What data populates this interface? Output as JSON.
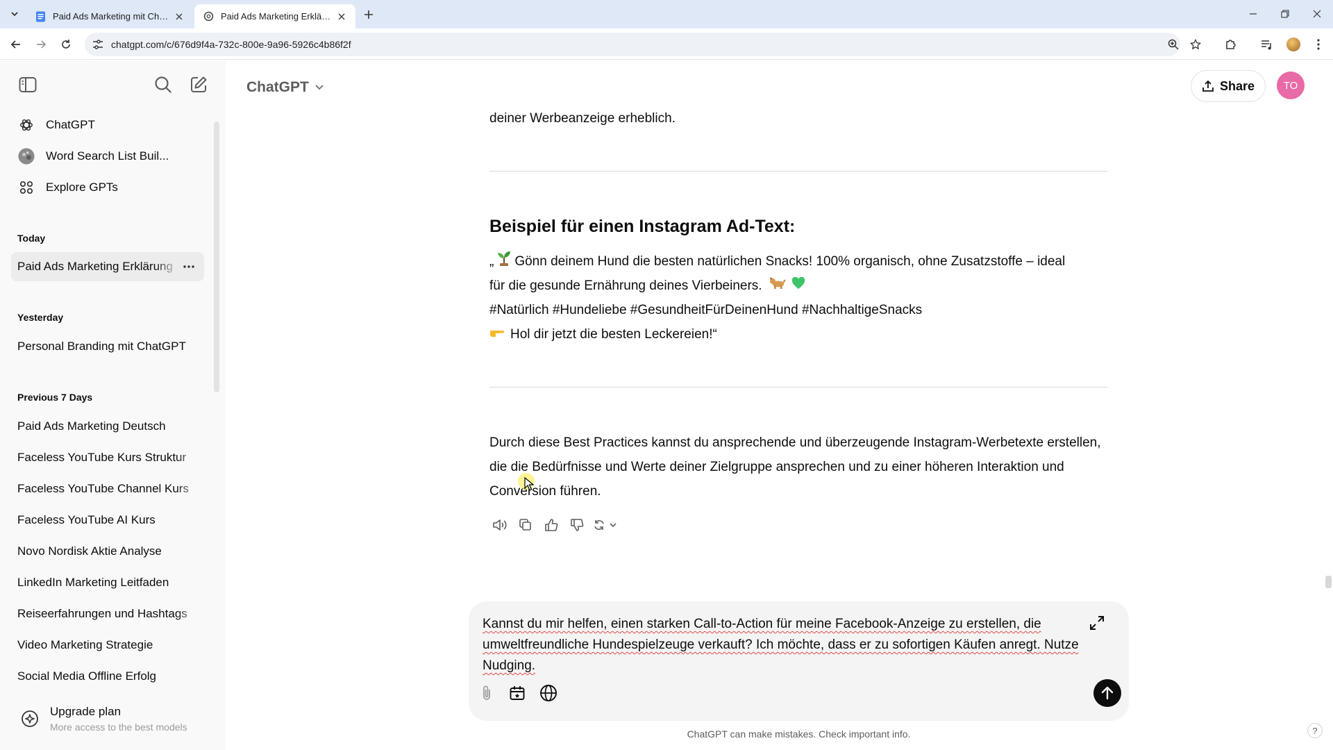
{
  "browser": {
    "tabs": [
      {
        "title": "Paid Ads Marketing mit ChatGPT",
        "active": false
      },
      {
        "title": "Paid Ads Marketing Erklärung",
        "active": true
      }
    ],
    "url": "chatgpt.com/c/676d9f4a-732c-800e-9a96-5926c4b86f2f"
  },
  "sidebar": {
    "top_items": [
      {
        "label": "ChatGPT",
        "icon": "openai-logo-icon"
      },
      {
        "label": "Word Search List Buil...",
        "icon": "gpt-avatar-icon"
      },
      {
        "label": "Explore GPTs",
        "icon": "grid-icon"
      }
    ],
    "sections": [
      {
        "heading": "Today",
        "items": [
          "Paid Ads Marketing Erklärung"
        ]
      },
      {
        "heading": "Yesterday",
        "items": [
          "Personal Branding mit ChatGPT"
        ]
      },
      {
        "heading": "Previous 7 Days",
        "items": [
          "Paid Ads Marketing Deutsch",
          "Faceless YouTube Kurs Struktur",
          "Faceless YouTube Channel Kurs",
          "Faceless YouTube AI Kurs",
          "Novo Nordisk Aktie Analyse",
          "LinkedIn Marketing Leitfaden",
          "Reiseerfahrungen und Hashtags",
          "Video Marketing Strategie",
          "Social Media Offline Erfolg"
        ]
      }
    ],
    "upgrade": {
      "title": "Upgrade plan",
      "subtitle": "More access to the best models"
    }
  },
  "header": {
    "model": "ChatGPT",
    "share_label": "Share",
    "avatar_initials": "TO"
  },
  "conversation": {
    "intro_line": "deiner Werbeanzeige erheblich.",
    "ad_heading": "Beispiel für einen Instagram Ad-Text:",
    "ad_lines": {
      "line1_prefix": "„",
      "line1_text": "Gönn deinem Hund die besten natürlichen Snacks! 100% organisch, ohne Zusatzstoffe – ideal",
      "line2_text": "für die gesunde Ernährung deines Vierbeiners.",
      "line3_text": "#Natürlich #Hundeliebe #GesundheitFürDeinenHund #NachhaltigeSnacks",
      "line4_text": "Hol dir jetzt die besten Leckereien!“"
    },
    "closing_paragraph": "Durch diese Best Practices kannst du ansprechende und überzeugende Instagram-Werbetexte erstellen, die die Bedürfnisse und Werte deiner Zielgruppe ansprechen und zu einer höheren Interaktion und Conversion führen."
  },
  "composer": {
    "text": "Kannst du mir helfen, einen starken Call-to-Action für meine Facebook-Anzeige zu erstellen, die umweltfreundliche Hundespielzeuge verkauft? Ich möchte, dass er zu sofortigen Käufen anregt. Nutze Nudging."
  },
  "disclaimer": "ChatGPT can make mistakes. Check important info.",
  "help_label": "?"
}
